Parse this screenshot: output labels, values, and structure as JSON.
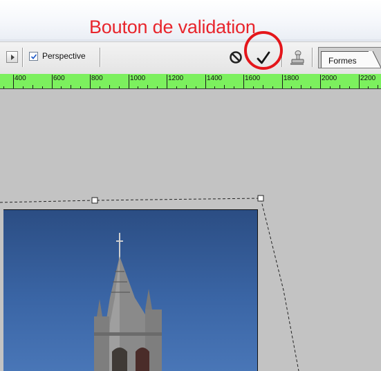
{
  "annotation": {
    "text": "Bouton de validation",
    "color": "#e8252c"
  },
  "options_bar": {
    "perspective": {
      "label": "Perspective",
      "checked": true
    },
    "cancel_icon": "cancel-transform-icon",
    "commit_icon": "checkmark-icon",
    "stamp_icon": "clone-stamp-icon",
    "shape_tab": {
      "label": "Formes"
    }
  },
  "ruler": {
    "labels": [
      "400",
      "600",
      "800",
      "1000",
      "1200",
      "1400",
      "1600",
      "1800",
      "2000",
      "2200"
    ],
    "color": "#7cf05e"
  },
  "canvas": {
    "background": "#c3c3c3"
  }
}
